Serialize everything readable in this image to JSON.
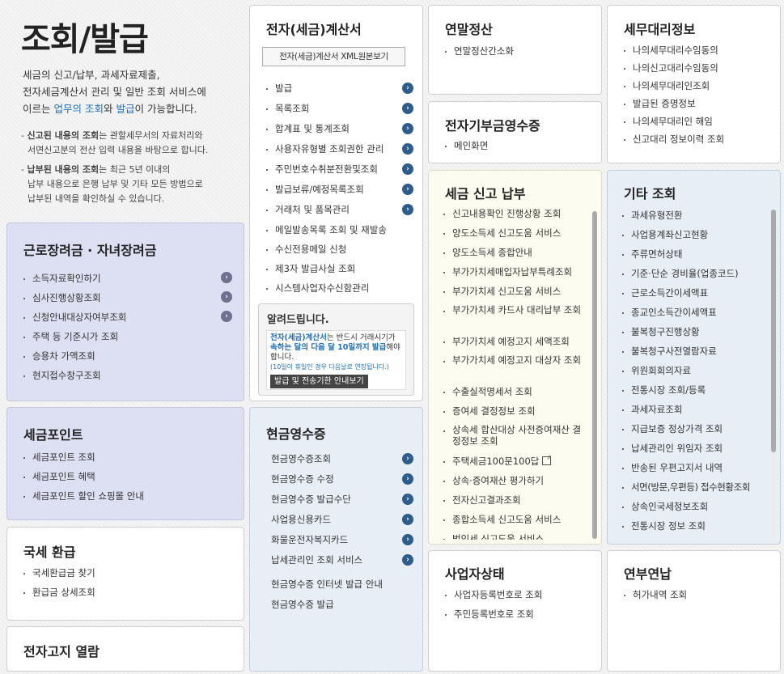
{
  "intro": {
    "title": "조회/발급",
    "desc": [
      "세금의 신고/납부, 과세자료제출,",
      "전자세금계산서 관리 및 일반 조회 서비스에"
    ],
    "desc3_pre": "이르는 ",
    "desc3_link1": "업무의 조회",
    "desc3_and": "와 ",
    "desc3_link2": "발급",
    "desc3_post": "이 가능합니다.",
    "note1_bold": "신고된 내용의 조회",
    "note1_text": "는 관할세무서의 자료처리와",
    "note1_line2": "서면신고분의 전산 입력 내용을 바탕으로 합니다.",
    "note2_bold": "납부된 내용의 조회",
    "note2_text": "는 최근 5년 이내의",
    "note2_line2": "납부 내용으로 은행 납부 및 기타 모든 방법으로",
    "note2_line3": "납부된 내역을 확인하실 수 있습니다."
  },
  "labor": {
    "title": "근로장려금 · 자녀장려금",
    "items": [
      "소득자료확인하기",
      "심사진행상황조회",
      "신청안내대상자여부조회",
      "주택 등 기준시가 조회",
      "승용차 가액조회",
      "현지접수창구조회"
    ]
  },
  "taxpoint": {
    "title": "세금포인트",
    "items": [
      "세금포인트 조회",
      "세금포인트 혜택",
      "세금포인트 할인 쇼핑몰 안내"
    ]
  },
  "refund": {
    "title": "국세 환급",
    "items": [
      "국세환급금 찾기",
      "환급금 상세조회"
    ]
  },
  "enotice": {
    "title": "전자고지 열람"
  },
  "einvoice": {
    "title": "전자(세금)계산서",
    "xml_button": "전자(세금)계산서 XML원본보기",
    "items": [
      "발급",
      "목록조회",
      "합계표 및 통계조회",
      "사용자유형별 조회권한 관리",
      "주민번호수취분전환및조회",
      "발급보류/예정목록조회",
      "거래처 및 품목관리",
      "메일발송목록 조회 및 재발송",
      "수신전용메일 신청",
      "제3자 발급사실 조회",
      "시스템사업자수신함관리"
    ],
    "notice_title": "알려드립니다.",
    "notice_b1": "전자(세금)계산서",
    "notice_t1": "는 반드시 거래시기가",
    "notice_b2": "속하는 달의 다음 달 10일까지 발급",
    "notice_t2": "해야",
    "notice_t3": "합니다.",
    "notice_small": "(10일이 휴일인 경우 다음날로 연장됩니다.)",
    "notice_button": "발급 및 전송기한 안내보기"
  },
  "cash": {
    "title": "현금영수증",
    "items": [
      "현금영수증조회",
      "현금영수증 수정",
      "현금영수증 발급수단",
      "사업용신용카드",
      "화물운전자복지카드",
      "납세관리인 조회 서비스"
    ],
    "extra": [
      "현금영수증 인터넷 발급 안내",
      "현금영수증 발급"
    ]
  },
  "yearend": {
    "title": "연말정산",
    "items": [
      "연말정산간소화"
    ]
  },
  "donation": {
    "title": "전자기부금영수증",
    "items": [
      "메인화면"
    ]
  },
  "filing": {
    "title": "세금 신고 납부",
    "items": [
      "신고내용확인 진행상황 조회",
      "양도소득세 신고도움 서비스",
      "양도소득세 종합안내",
      "부가가치세매입자납부특례조회",
      "부가가치세 신고도움 서비스",
      "부가가치세 카드사 대리납부 조회",
      "부가가치세 예정고지 세액조회",
      "부가가치세 예정고지 대상자 조회",
      "수출실적명세서 조회",
      "증여세 결정정보 조회",
      "상속세 합산대상 사전증여재산 결정정보 조회",
      "주택세금100문100답",
      "상속·증여재산 평가하기",
      "전자신고결과조회",
      "종합소득세 신고도움 서비스",
      "법인세 신고도움 서비스"
    ]
  },
  "bizstatus": {
    "title": "사업자상태",
    "items": [
      "사업자등록번호로 조회",
      "주민등록번호로 조회"
    ]
  },
  "agent": {
    "title": "세무대리정보",
    "items": [
      "나의세무대리수임동의",
      "나의신고대리수임동의",
      "나의세무대리인조회",
      "발급된 증명정보",
      "나의세무대리인 해임",
      "신고대리 정보이력 조회"
    ]
  },
  "other": {
    "title": "기타 조회",
    "items": [
      "과세유형전환",
      "사업용계좌신고현황",
      "주류면허상태",
      "기준·단순 경비율(업종코드)",
      "근로소득간이세액표",
      "종교인소득간이세액표",
      "불복청구진행상황",
      "불복청구사전열람자료",
      "위원회회의자료",
      "전통시장 조회/등록",
      "과세자료조회",
      "지급보증 정상가격 조회",
      "납세관리인 위임자 조회",
      "반송된 우편고지서 내역",
      "서면(방문,우편등) 접수현황조회",
      "상속인국세정보조회",
      "전통시장 정보 조회"
    ]
  },
  "yeonbu": {
    "title": "연부연납",
    "items": [
      "허가내역 조회"
    ]
  },
  "colors": {
    "accent_blue": "#1b6fb8",
    "arrow_blue": "#2e5c8c",
    "lavender": "#dddff2",
    "cream": "#fdfcf0",
    "light_blue": "#e8eef6"
  },
  "icons": {
    "arrow": "chevron-right-circle-icon",
    "external": "external-link-icon"
  }
}
